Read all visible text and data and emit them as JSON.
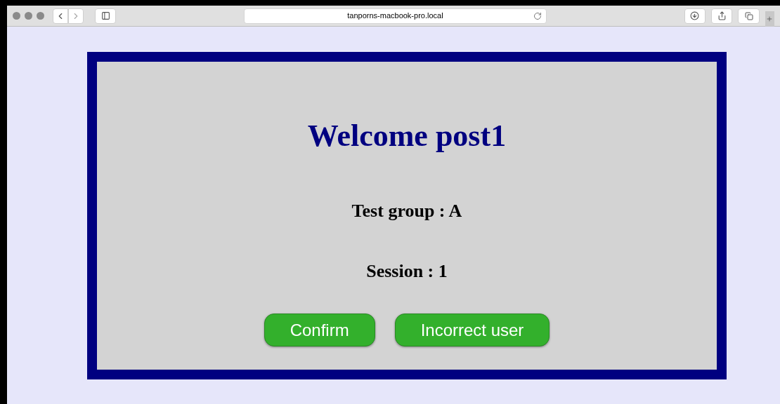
{
  "browser": {
    "address": "tanporns-macbook-pro.local"
  },
  "page": {
    "title": "Welcome post1",
    "lines": [
      "Test group : A",
      "Session : 1"
    ],
    "buttons": [
      "Confirm",
      "Incorrect user"
    ]
  }
}
